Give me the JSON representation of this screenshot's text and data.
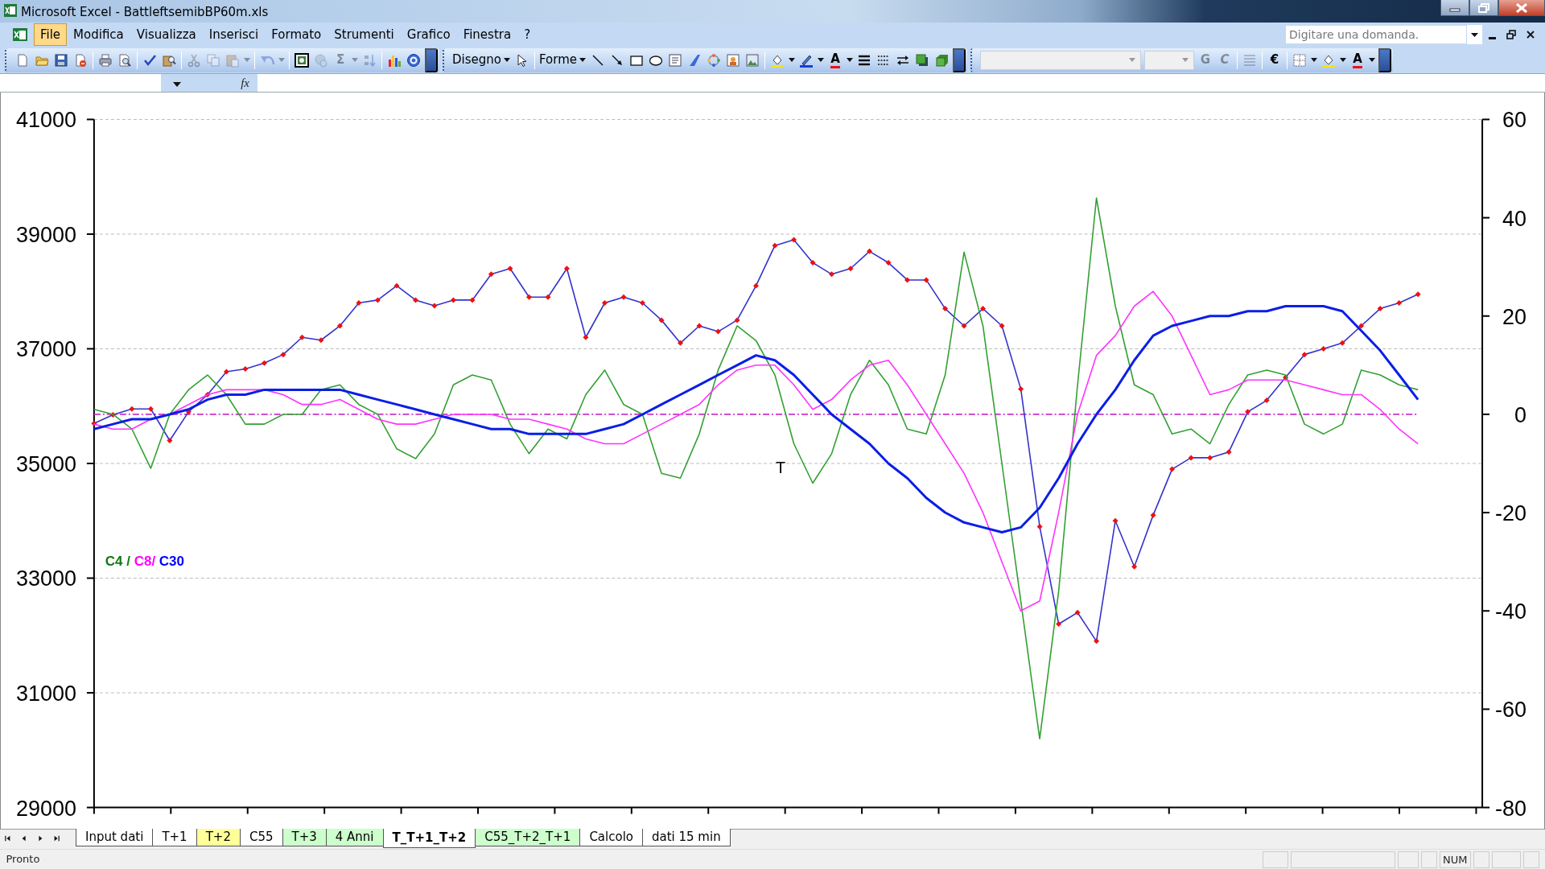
{
  "window": {
    "title": "Microsoft Excel - BattleftsemibBP60m.xls"
  },
  "menu": [
    {
      "label": "File",
      "selected": true
    },
    {
      "label": "Modifica",
      "selected": false
    },
    {
      "label": "Visualizza",
      "selected": false
    },
    {
      "label": "Inserisci",
      "selected": false
    },
    {
      "label": "Formato",
      "selected": false
    },
    {
      "label": "Strumenti",
      "selected": false
    },
    {
      "label": "Grafico",
      "selected": false
    },
    {
      "label": "Finestra",
      "selected": false
    },
    {
      "label": "?",
      "selected": false
    }
  ],
  "help_search": {
    "placeholder": "Digitare una domanda."
  },
  "toolbars": [
    {
      "items": [
        {
          "kind": "new",
          "disabled": false
        },
        {
          "kind": "open",
          "disabled": false
        },
        {
          "kind": "save",
          "disabled": false
        },
        {
          "kind": "permission",
          "disabled": false
        },
        {
          "kind": "sep"
        },
        {
          "kind": "print",
          "disabled": false
        },
        {
          "kind": "preview",
          "disabled": false
        },
        {
          "kind": "sep"
        },
        {
          "kind": "spell",
          "disabled": false
        },
        {
          "kind": "research",
          "disabled": false
        },
        {
          "kind": "sep"
        },
        {
          "kind": "cut",
          "disabled": true
        },
        {
          "kind": "copy",
          "disabled": true
        },
        {
          "kind": "paste",
          "disabled": true
        },
        {
          "kind": "caret",
          "disabled": true
        },
        {
          "kind": "sep"
        },
        {
          "kind": "undo",
          "disabled": true
        },
        {
          "kind": "caret",
          "disabled": true
        },
        {
          "kind": "sep"
        },
        {
          "kind": "camera",
          "disabled": false
        },
        {
          "kind": "link",
          "disabled": true
        },
        {
          "kind": "glyph",
          "label": "Σ",
          "disabled": true
        },
        {
          "kind": "caret",
          "disabled": true
        },
        {
          "kind": "sort",
          "disabled": true
        },
        {
          "kind": "sep"
        },
        {
          "kind": "chart",
          "disabled": false
        },
        {
          "kind": "help",
          "disabled": false
        },
        {
          "kind": "overflow"
        }
      ]
    },
    {
      "items": [
        {
          "kind": "menu",
          "label": "Disegno",
          "disabled": false
        },
        {
          "kind": "pointer",
          "disabled": false
        },
        {
          "kind": "sep"
        },
        {
          "kind": "menu",
          "label": "Forme",
          "disabled": false
        },
        {
          "kind": "line",
          "disabled": false
        },
        {
          "kind": "arrow",
          "disabled": false
        },
        {
          "kind": "rect",
          "disabled": false
        },
        {
          "kind": "oval",
          "disabled": false
        },
        {
          "kind": "textbox",
          "disabled": false
        },
        {
          "kind": "wordart",
          "disabled": false
        },
        {
          "kind": "diagram",
          "disabled": false
        },
        {
          "kind": "clipart",
          "disabled": false
        },
        {
          "kind": "picture",
          "disabled": false
        },
        {
          "kind": "sep"
        },
        {
          "kind": "fill",
          "disabled": false
        },
        {
          "kind": "caret",
          "disabled": false
        },
        {
          "kind": "pen",
          "disabled": false
        },
        {
          "kind": "caret",
          "disabled": false
        },
        {
          "kind": "fontcolor",
          "label": "A",
          "disabled": false
        },
        {
          "kind": "caret",
          "disabled": false
        },
        {
          "kind": "linestyle",
          "disabled": false
        },
        {
          "kind": "dashstyle",
          "disabled": false
        },
        {
          "kind": "arrows",
          "disabled": false
        },
        {
          "kind": "shadow",
          "disabled": false
        },
        {
          "kind": "cube",
          "disabled": false
        },
        {
          "kind": "overflow"
        }
      ]
    },
    {
      "items": [
        {
          "kind": "fontcombo"
        },
        {
          "kind": "sizecombo"
        },
        {
          "kind": "glyph",
          "label": "G",
          "disabled": true
        },
        {
          "kind": "italic",
          "label": "C",
          "disabled": true
        },
        {
          "kind": "sep"
        },
        {
          "kind": "align",
          "disabled": true
        },
        {
          "kind": "sep"
        },
        {
          "kind": "glyph",
          "label": "€",
          "disabled": false
        },
        {
          "kind": "sep"
        },
        {
          "kind": "borders",
          "disabled": false
        },
        {
          "kind": "caret",
          "disabled": false
        },
        {
          "kind": "fill",
          "disabled": false
        },
        {
          "kind": "caret",
          "disabled": false
        },
        {
          "kind": "fontcolor",
          "label": "A",
          "disabled": false
        },
        {
          "kind": "caret",
          "disabled": false
        },
        {
          "kind": "overflow"
        }
      ]
    }
  ],
  "formula_bar": {
    "function_label": "fx"
  },
  "chart": {
    "chart_data": {
      "type": "line",
      "ylim": [
        29000,
        41000
      ],
      "yticks": [
        29000,
        31000,
        33000,
        35000,
        37000,
        39000,
        41000
      ],
      "y2lim": [
        -80,
        60
      ],
      "y2ticks": [
        -80,
        -60,
        -40,
        -20,
        0,
        20,
        40,
        60
      ],
      "grid": true,
      "series": [
        {
          "color": "#3333cc",
          "values": [
            35700,
            35850,
            35950,
            35950,
            35400,
            35900,
            36200,
            36600,
            36650,
            36750,
            36900,
            37200,
            37150,
            37400,
            37800,
            37850,
            38100,
            37850,
            37750,
            37850,
            37850,
            38300,
            38400,
            37900,
            37900,
            38400,
            37200,
            37800,
            37900,
            37800,
            37500,
            37100,
            37400,
            37300,
            37500,
            38100,
            38800,
            38900,
            38500,
            38300,
            38400,
            38700,
            38500,
            38200,
            38200,
            37700,
            37400,
            37700,
            37400,
            36300,
            33900,
            32200,
            32400,
            31900,
            34000,
            33200,
            34100,
            34900,
            35100,
            35100,
            35200,
            35900,
            36100,
            36500,
            36900,
            37000,
            37100,
            37400,
            37700,
            37800,
            37950
          ]
        },
        {
          "axis": "y2",
          "color": "#33a033",
          "values": [
            1,
            0,
            -3,
            -11,
            0,
            5,
            8,
            4,
            -2,
            -2,
            0,
            0,
            5,
            6,
            2,
            0,
            -7,
            -9,
            -4,
            6,
            8,
            7,
            -2,
            -8,
            -3,
            -5,
            4,
            9,
            2,
            0,
            -12,
            -13,
            -4,
            9,
            18,
            15,
            8,
            -6,
            -14,
            -8,
            4,
            11,
            6,
            -3,
            -4,
            8,
            33,
            18,
            -10,
            -38,
            -66,
            -36,
            6,
            44,
            22,
            6,
            4,
            -4,
            -3,
            -6,
            2,
            8,
            9,
            8,
            -2,
            -4,
            -2,
            9,
            8,
            6,
            5
          ]
        },
        {
          "axis": "y2",
          "color": "#ff33ff",
          "values": [
            -2,
            -3,
            -3,
            -1,
            0,
            2,
            4,
            5,
            5,
            5,
            4,
            2,
            2,
            3,
            1,
            -1,
            -2,
            -2,
            -1,
            0,
            0,
            0,
            -1,
            -1,
            -2,
            -3,
            -5,
            -6,
            -6,
            -4,
            -2,
            0,
            2,
            6,
            9,
            10,
            10,
            6,
            1,
            3,
            7,
            10,
            11,
            6,
            0,
            -6,
            -12,
            -20,
            -30,
            -40,
            -38,
            -20,
            0,
            12,
            16,
            22,
            25,
            20,
            12,
            4,
            5,
            7,
            7,
            7,
            6,
            5,
            4,
            4,
            1,
            -3,
            -6
          ]
        },
        {
          "axis": "y2",
          "color": "#0a1ee6",
          "values": [
            -3,
            -2,
            -1,
            -1,
            0,
            1,
            3,
            4,
            4,
            5,
            5,
            5,
            5,
            5,
            4,
            3,
            2,
            1,
            0,
            -1,
            -2,
            -3,
            -3,
            -4,
            -4,
            -4,
            -4,
            -3,
            -2,
            0,
            2,
            4,
            6,
            8,
            10,
            12,
            11,
            8,
            4,
            0,
            -3,
            -6,
            -10,
            -13,
            -17,
            -20,
            -22,
            -23,
            -24,
            -23,
            -19,
            -13,
            -6,
            0,
            5,
            11,
            16,
            18,
            19,
            20,
            20,
            21,
            21,
            22,
            22,
            22,
            21,
            17,
            13,
            8,
            3
          ]
        }
      ],
      "ref_lines": [
        {
          "axis": "y2",
          "value": 0,
          "color": "#cc33cc"
        }
      ],
      "annotations": [
        "T"
      ]
    },
    "point_markers": {
      "color": "#ee1111"
    },
    "legend": [
      {
        "text": "C4",
        "color": "#127a12"
      },
      {
        "text": "/",
        "color": "#127a12"
      },
      {
        "text": "C8/",
        "color": "#ff00ff"
      },
      {
        "text": "C30",
        "color": "#0000ff"
      }
    ]
  },
  "sheet_tabs": [
    {
      "label": "Input dati",
      "selected": false,
      "color": "#ffffff"
    },
    {
      "label": "T+1",
      "selected": false,
      "color": "#ffffff"
    },
    {
      "label": "T+2",
      "selected": false,
      "color": "#ffff99"
    },
    {
      "label": "C55",
      "selected": false,
      "color": "#ffffff"
    },
    {
      "label": "T+3",
      "selected": false,
      "color": "#ccffcc"
    },
    {
      "label": "4 Anni",
      "selected": false,
      "color": "#ccffcc"
    },
    {
      "label": "T_T+1_T+2",
      "selected": true,
      "color": "#ffffff"
    },
    {
      "label": "C55_T+2_T+1",
      "selected": false,
      "color": "#ccffcc"
    },
    {
      "label": "Calcolo",
      "selected": false,
      "color": "#ffffff"
    },
    {
      "label": "dati 15 min",
      "selected": false,
      "color": "#ffffff"
    }
  ],
  "status_bar": {
    "text": "Pronto",
    "indicators": [
      "NUM"
    ]
  }
}
